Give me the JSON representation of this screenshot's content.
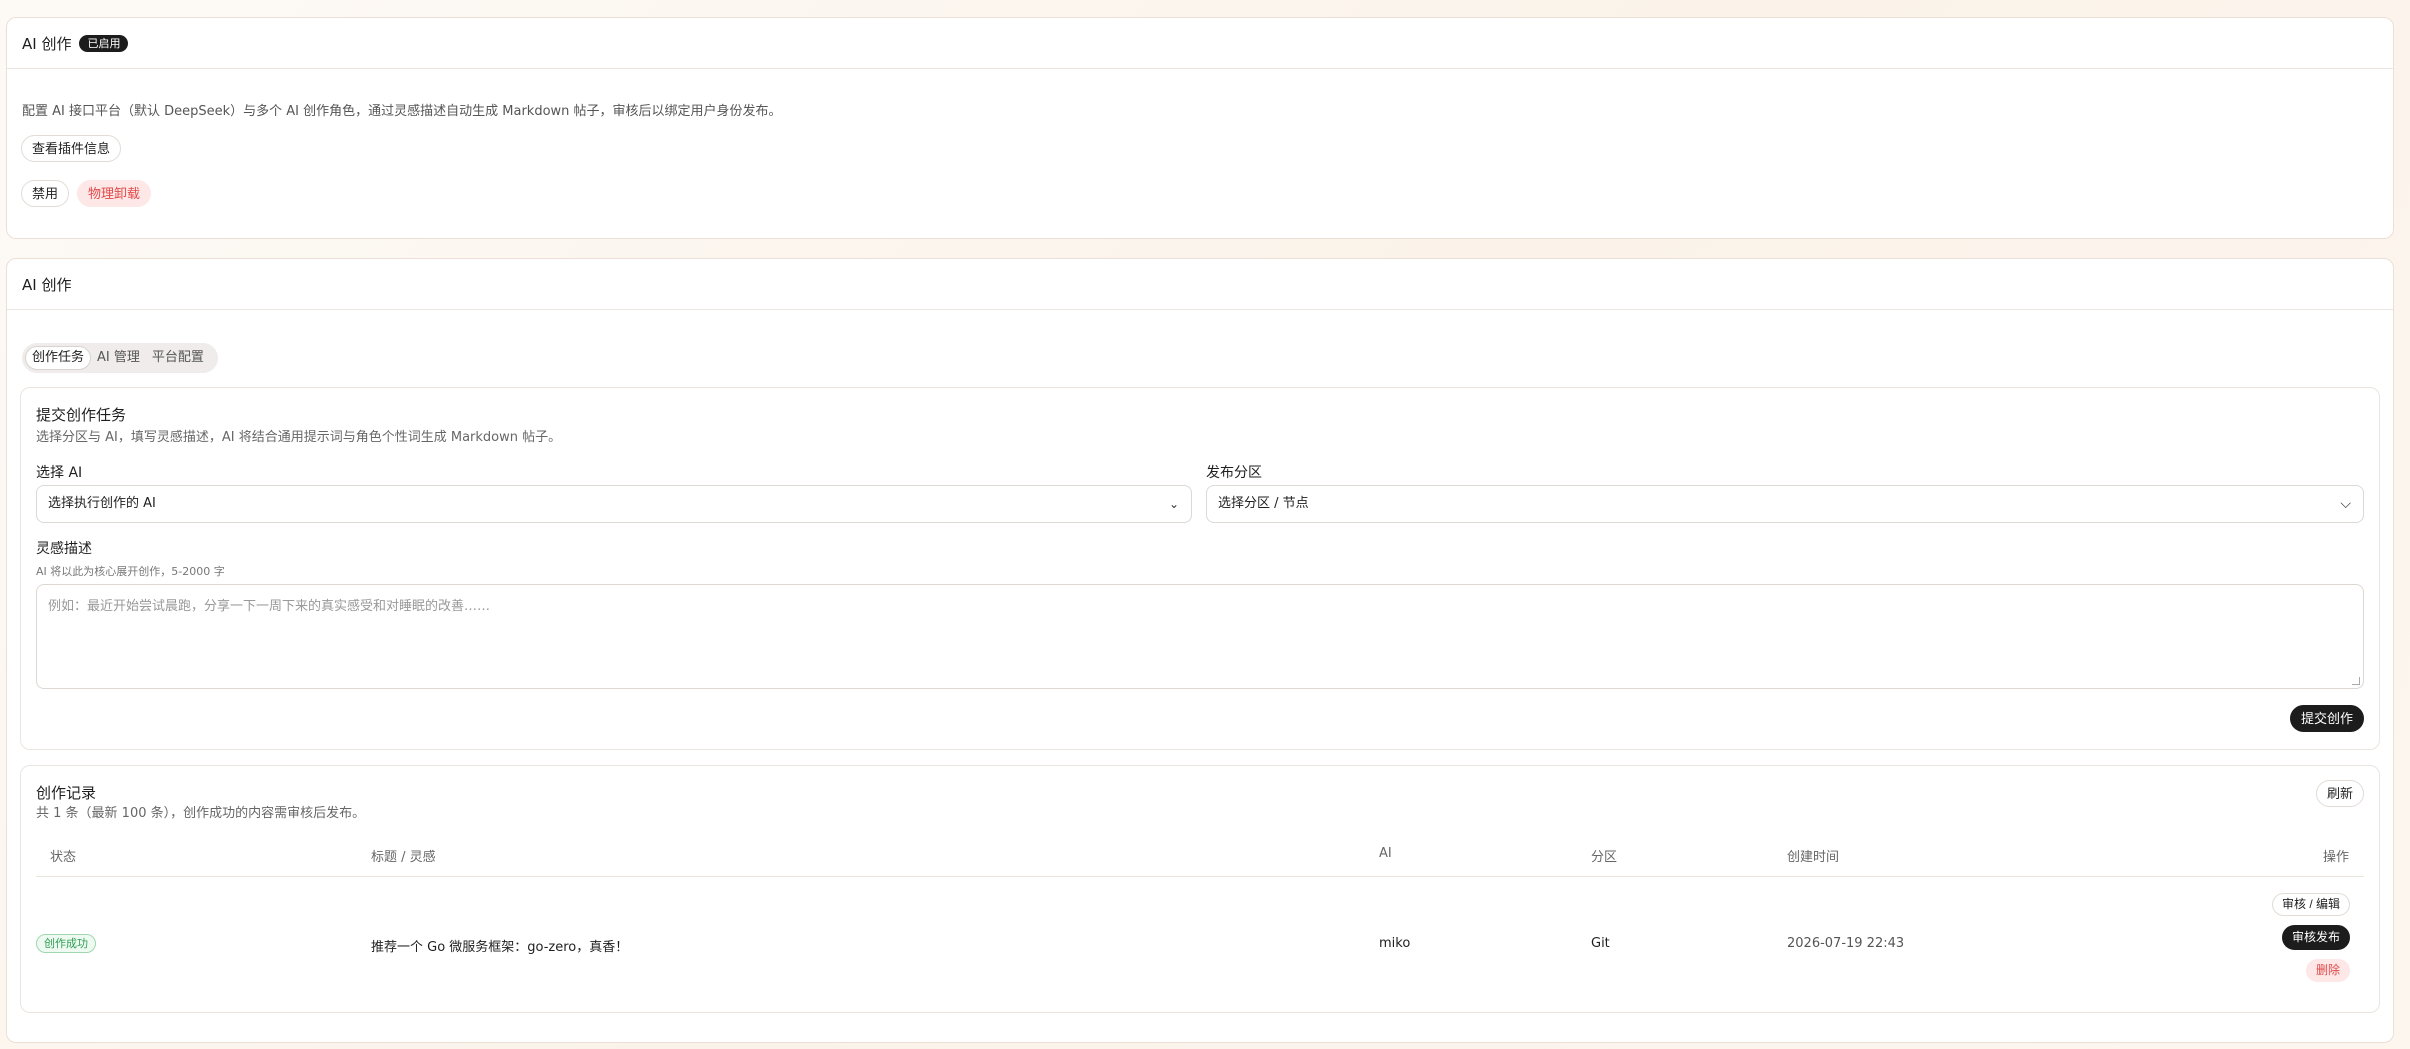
{
  "plugin": {
    "title": "AI 创作",
    "status_badge": "已启用",
    "description": "配置 AI 接口平台（默认 DeepSeek）与多个 AI 创作角色，通过灵感描述自动生成 Markdown 帖子，审核后以绑定用户身份发布。",
    "info_button": "查看插件信息",
    "disable_button": "禁用",
    "uninstall_button": "物理卸载"
  },
  "main": {
    "title": "AI 创作",
    "tabs": [
      {
        "label": "创作任务",
        "active": true
      },
      {
        "label": "AI 管理",
        "active": false
      },
      {
        "label": "平台配置",
        "active": false
      }
    ]
  },
  "form": {
    "title": "提交创作任务",
    "subtitle": "选择分区与 AI，填写灵感描述，AI 将结合通用提示词与角色个性词生成 Markdown 帖子。",
    "ai_label": "选择 AI",
    "ai_placeholder": "选择执行创作的 AI",
    "section_label": "发布分区",
    "section_placeholder": "选择分区 / 节点",
    "inspiration_label": "灵感描述",
    "inspiration_hint": "AI 将以此为核心展开创作，5-2000 字",
    "inspiration_placeholder": "例如：最近开始尝试晨跑，分享一下一周下来的真实感受和对睡眠的改善……",
    "submit_button": "提交创作"
  },
  "records": {
    "title": "创作记录",
    "subtitle": "共 1 条（最新 100 条），创作成功的内容需审核后发布。",
    "refresh_button": "刷新",
    "columns": {
      "status": "状态",
      "title": "标题 / 灵感",
      "ai": "AI",
      "section": "分区",
      "created": "创建时间",
      "actions": "操作"
    },
    "rows": [
      {
        "status": "创作成功",
        "title": "推荐一个 Go 微服务框架：go-zero，真香！",
        "ai": "miko",
        "section": "Git",
        "created": "2026-07-19 22:43",
        "action_review_edit": "审核 / 编辑",
        "action_publish": "审核发布",
        "action_delete": "删除"
      }
    ]
  },
  "colors": {
    "accent_dark": "#1c1c1c",
    "success": "#2e9e52",
    "danger": "#e24a4a"
  }
}
